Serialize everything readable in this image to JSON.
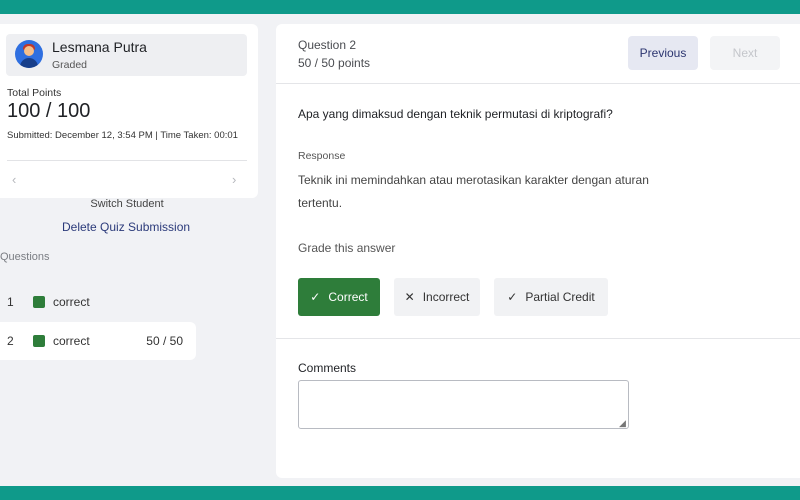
{
  "student": {
    "name": "Lesmana Putra",
    "status": "Graded",
    "total_points_label": "Total Points",
    "total_points": "100 / 100",
    "submitted_info": "Submitted: December 12, 3:54 PM | Time Taken: 00:01",
    "switch_label": "Switch Student"
  },
  "sidebar": {
    "delete_label": "Delete Quiz Submission",
    "questions_heading": "Questions",
    "questions": [
      {
        "number": "1",
        "status": "correct",
        "score": ""
      },
      {
        "number": "2",
        "status": "correct",
        "score": "50 / 50"
      }
    ]
  },
  "question": {
    "title": "Question 2",
    "points": "50 / 50 points",
    "prompt": "Apa yang dimaksud dengan teknik permutasi di kriptografi?",
    "response_label": "Response",
    "response_text": "Teknik ini memindahkan atau merotasikan karakter dengan aturan tertentu."
  },
  "navigation": {
    "previous_label": "Previous",
    "next_label": "Next"
  },
  "grading": {
    "label": "Grade this answer",
    "correct_label": "Correct",
    "incorrect_label": "Incorrect",
    "partial_label": "Partial Credit"
  },
  "comments": {
    "label": "Comments",
    "value": ""
  },
  "colors": {
    "band": "#0f9a8a",
    "correct": "#2e7d3a",
    "link": "#2b3a7a"
  }
}
